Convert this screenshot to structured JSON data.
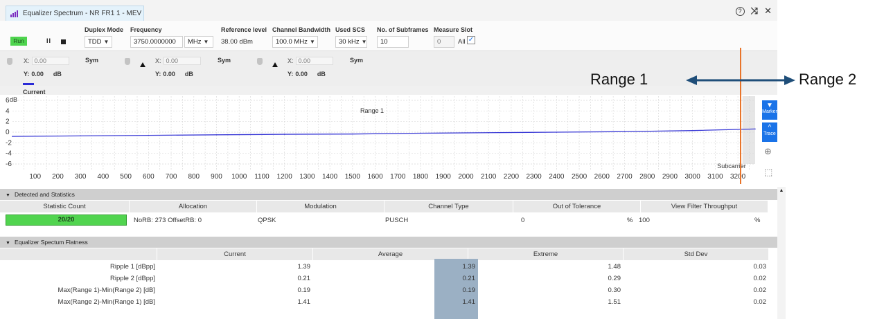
{
  "window": {
    "tab_title": "Equalizer Spectrum - NR FR1 1 - MEV",
    "help_icon": "help-icon",
    "collapse_icon": "collapse-icon",
    "close_icon": "close-icon"
  },
  "toolbar": {
    "run_label": "Run",
    "pause_label": "II",
    "duplex_mode": {
      "label": "Duplex Mode",
      "value": "TDD"
    },
    "frequency": {
      "label": "Frequency",
      "value": "3750.0000000",
      "unit": "MHz"
    },
    "reference_level": {
      "label": "Reference level",
      "value": "38.00 dBm"
    },
    "channel_bandwidth": {
      "label": "Channel Bandwidth",
      "value": "100.0 MHz"
    },
    "used_scs": {
      "label": "Used SCS",
      "value": "30 kHz"
    },
    "subframes": {
      "label": "No. of Subframes",
      "value": "10"
    },
    "measure_slot": {
      "label": "Measure Slot",
      "value": "0",
      "all_label": "All",
      "all_checked": true
    }
  },
  "markers": [
    {
      "x_label": "X:",
      "x_value": "0.00",
      "sym": "Sym",
      "y_label": "Y:",
      "y_value": "0.00",
      "y_unit": "dB"
    },
    {
      "x_label": "X:",
      "x_value": "0.00",
      "sym": "Sym",
      "y_label": "Y:",
      "y_value": "0.00",
      "y_unit": "dB"
    },
    {
      "x_label": "X:",
      "x_value": "0.00",
      "sym": "Sym",
      "y_label": "Y:",
      "y_value": "0.00",
      "y_unit": "dB"
    }
  ],
  "legend": {
    "label": "Current",
    "color": "#2b2bd6"
  },
  "chart_data": {
    "type": "line",
    "title": "",
    "ylabel": "dB",
    "xlabel": "Subcarrier",
    "ylim": [
      -6,
      6
    ],
    "xlim": [
      0,
      3276
    ],
    "yticks": [
      6,
      4,
      2,
      0,
      -2,
      -4,
      -6
    ],
    "xticks": [
      100,
      200,
      300,
      400,
      500,
      600,
      700,
      800,
      900,
      1000,
      1100,
      1200,
      1300,
      1400,
      1500,
      1600,
      1700,
      1800,
      1900,
      2000,
      2100,
      2200,
      2300,
      2400,
      2500,
      2600,
      2700,
      2800,
      2900,
      3000,
      3100,
      3200
    ],
    "annotation": "Range 1",
    "grid": true,
    "series": [
      {
        "name": "Current",
        "color": "#3b3bd6",
        "x": [
          0,
          300,
          600,
          900,
          1200,
          1500,
          1800,
          2100,
          2400,
          2700,
          3000,
          3276
        ],
        "values": [
          -0.8,
          -0.7,
          -0.6,
          -0.5,
          -0.4,
          -0.35,
          -0.2,
          -0.1,
          0.0,
          0.1,
          0.3,
          0.6
        ]
      }
    ]
  },
  "side_tools": {
    "marker_label": "Marker",
    "trace_label": "Trace"
  },
  "detected": {
    "section_title": "Detected and Statistics",
    "headers": [
      "Statistic Count",
      "Allocation",
      "Modulation",
      "Channel Type",
      "Out of Tolerance",
      "View Filter Throughput"
    ],
    "statistic_count": "20/20",
    "allocation": "NoRB: 273 OffsetRB: 0",
    "modulation": "QPSK",
    "channel_type": "PUSCH",
    "out_of_tolerance": "0",
    "oot_unit": "%",
    "throughput": "100",
    "tp_unit": "%"
  },
  "flatness": {
    "section_title": "Equalizer Spectum Flatness",
    "headers": [
      "Current",
      "Average",
      "Extreme",
      "Std Dev"
    ],
    "rows": [
      {
        "label": "Ripple 1 [dBpp]",
        "current": "1.39",
        "average": "1.39",
        "extreme": "1.48",
        "std": "0.03"
      },
      {
        "label": "Ripple 2 [dBpp]",
        "current": "0.21",
        "average": "0.21",
        "extreme": "0.29",
        "std": "0.02"
      },
      {
        "label": "Max(Range 1)-Min(Range 2) [dB]",
        "current": "0.19",
        "average": "0.19",
        "extreme": "0.30",
        "std": "0.02"
      },
      {
        "label": "Max(Range 2)-Min(Range 1) [dB]",
        "current": "1.41",
        "average": "1.41",
        "extreme": "1.51",
        "std": "0.02"
      }
    ]
  },
  "overlay": {
    "range1": "Range 1",
    "range2": "Range 2",
    "divider_color": "#e8742a",
    "arrow_color": "#1f4e79"
  }
}
